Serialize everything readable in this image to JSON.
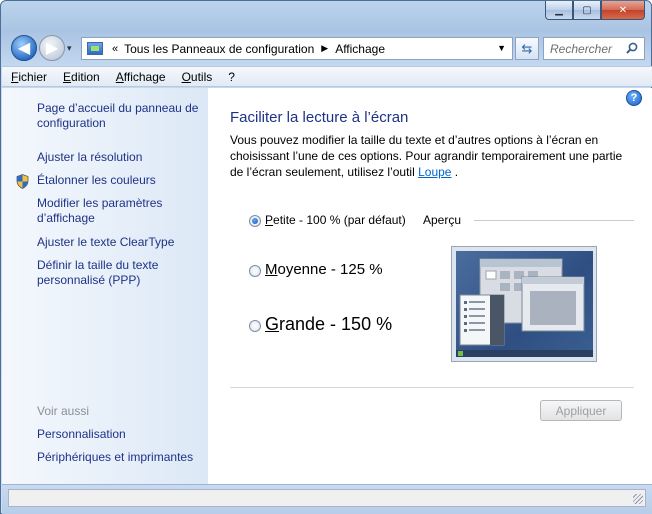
{
  "window": {
    "minimize_glyph": "▁",
    "maximize_glyph": "▢",
    "close_glyph": "✕"
  },
  "nav": {
    "back_glyph": "◀",
    "forward_glyph": "▶",
    "history_glyph": "▾",
    "breadcrumb_sep": "«",
    "breadcrumbs": [
      "Tous les Panneaux de configuration",
      "Affichage"
    ],
    "crumb_arrow": "▶",
    "address_dropdown_glyph": "▼",
    "refresh_glyph": "⇆",
    "search_placeholder": "Rechercher"
  },
  "menu": [
    "Fichier",
    "Edition",
    "Affichage",
    "Outils",
    "?"
  ],
  "sidebar": {
    "links": [
      "Page d’accueil du panneau de configuration",
      "Ajuster la résolution",
      "Étalonner les couleurs",
      "Modifier les paramètres d’affichage",
      "Ajuster le texte ClearType",
      "Définir la taille du texte personnalisé (PPP)"
    ],
    "see_also_title": "Voir aussi",
    "see_also": [
      "Personnalisation",
      "Périphériques et imprimantes"
    ]
  },
  "main": {
    "help_glyph": "?",
    "heading": "Faciliter la lecture à l’écran",
    "description": "Vous pouvez modifier la taille du texte et d’autres options à l’écran en choisissant l’une de ces options. Pour agrandir temporairement une partie de l’écran seulement, utilisez l’outil ",
    "loupe_link": "Loupe",
    "description_end": " .",
    "options": [
      {
        "first": "P",
        "rest": "etite - 100 % (par défaut)",
        "selected": true
      },
      {
        "first": "M",
        "rest": "oyenne - 125 %",
        "selected": false
      },
      {
        "first": "G",
        "rest": "rande - 150 %",
        "selected": false
      }
    ],
    "preview_label": "Aperçu",
    "apply_button": "Appliquer"
  },
  "colors": {
    "link": "#1e3287",
    "accent_blue": "#2d6cc0",
    "sidebar_gradient_end": "#dce8f6"
  }
}
